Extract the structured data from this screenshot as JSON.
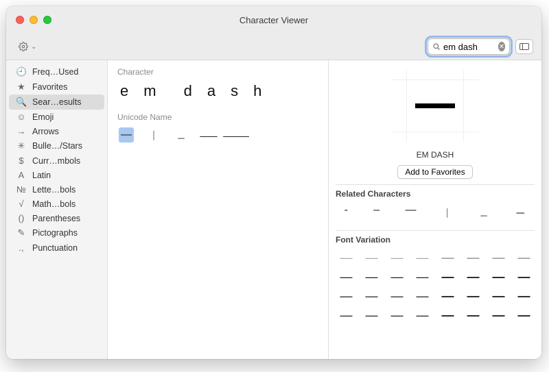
{
  "window": {
    "title": "Character Viewer"
  },
  "toolbar": {
    "gear_label": "⚙︎",
    "disclosure": "⌄"
  },
  "search": {
    "value": "em dash",
    "placeholder": ""
  },
  "sidebar": {
    "items": [
      {
        "icon": "🕘",
        "label": "Freq…Used",
        "selected": false,
        "name": "frequently-used"
      },
      {
        "icon": "★",
        "label": "Favorites",
        "selected": false,
        "name": "favorites"
      },
      {
        "icon": "🔍",
        "label": "Sear…esults",
        "selected": true,
        "name": "search-results"
      },
      {
        "icon": "☺",
        "label": "Emoji",
        "selected": false,
        "name": "emoji"
      },
      {
        "icon": "→",
        "label": "Arrows",
        "selected": false,
        "name": "arrows"
      },
      {
        "icon": "✳",
        "label": "Bulle…/Stars",
        "selected": false,
        "name": "bullets-stars"
      },
      {
        "icon": "$",
        "label": "Curr…mbols",
        "selected": false,
        "name": "currency-symbols"
      },
      {
        "icon": "A",
        "label": "Latin",
        "selected": false,
        "name": "latin"
      },
      {
        "icon": "№",
        "label": "Lette…bols",
        "selected": false,
        "name": "letterlike-symbols"
      },
      {
        "icon": "√",
        "label": "Math…bols",
        "selected": false,
        "name": "math-symbols"
      },
      {
        "icon": "()",
        "label": "Parentheses",
        "selected": false,
        "name": "parentheses"
      },
      {
        "icon": "✎",
        "label": "Pictographs",
        "selected": false,
        "name": "pictographs"
      },
      {
        "icon": ".,",
        "label": "Punctuation",
        "selected": false,
        "name": "punctuation"
      }
    ]
  },
  "center": {
    "character_heading": "Character",
    "char_letters": [
      "e",
      "m",
      "d",
      "a",
      "s",
      "h"
    ],
    "unicode_heading": "Unicode Name",
    "unicode_results": [
      {
        "glyph": "—",
        "selected": true
      },
      {
        "glyph": "︱",
        "selected": false
      },
      {
        "glyph": "﹘",
        "selected": false
      },
      {
        "glyph": "⸺",
        "selected": false
      },
      {
        "glyph": "⸻",
        "selected": false
      }
    ]
  },
  "detail": {
    "char_display": "—",
    "char_name": "EM DASH",
    "add_favorites_label": "Add to Favorites",
    "related_heading": "Related Characters",
    "related": [
      "‑",
      "–",
      "―",
      "︱",
      "﹘",
      "－"
    ],
    "fontvar_heading": "Font Variation",
    "fontvars": [
      "—",
      "—",
      "—",
      "—",
      "—",
      "—",
      "—",
      "—",
      "—",
      "—",
      "—",
      "—",
      "—",
      "—",
      "—",
      "—",
      "—",
      "—",
      "—",
      "—",
      "—",
      "—",
      "—",
      "—",
      "—",
      "—",
      "—",
      "—",
      "—",
      "—",
      "—",
      "—"
    ]
  }
}
